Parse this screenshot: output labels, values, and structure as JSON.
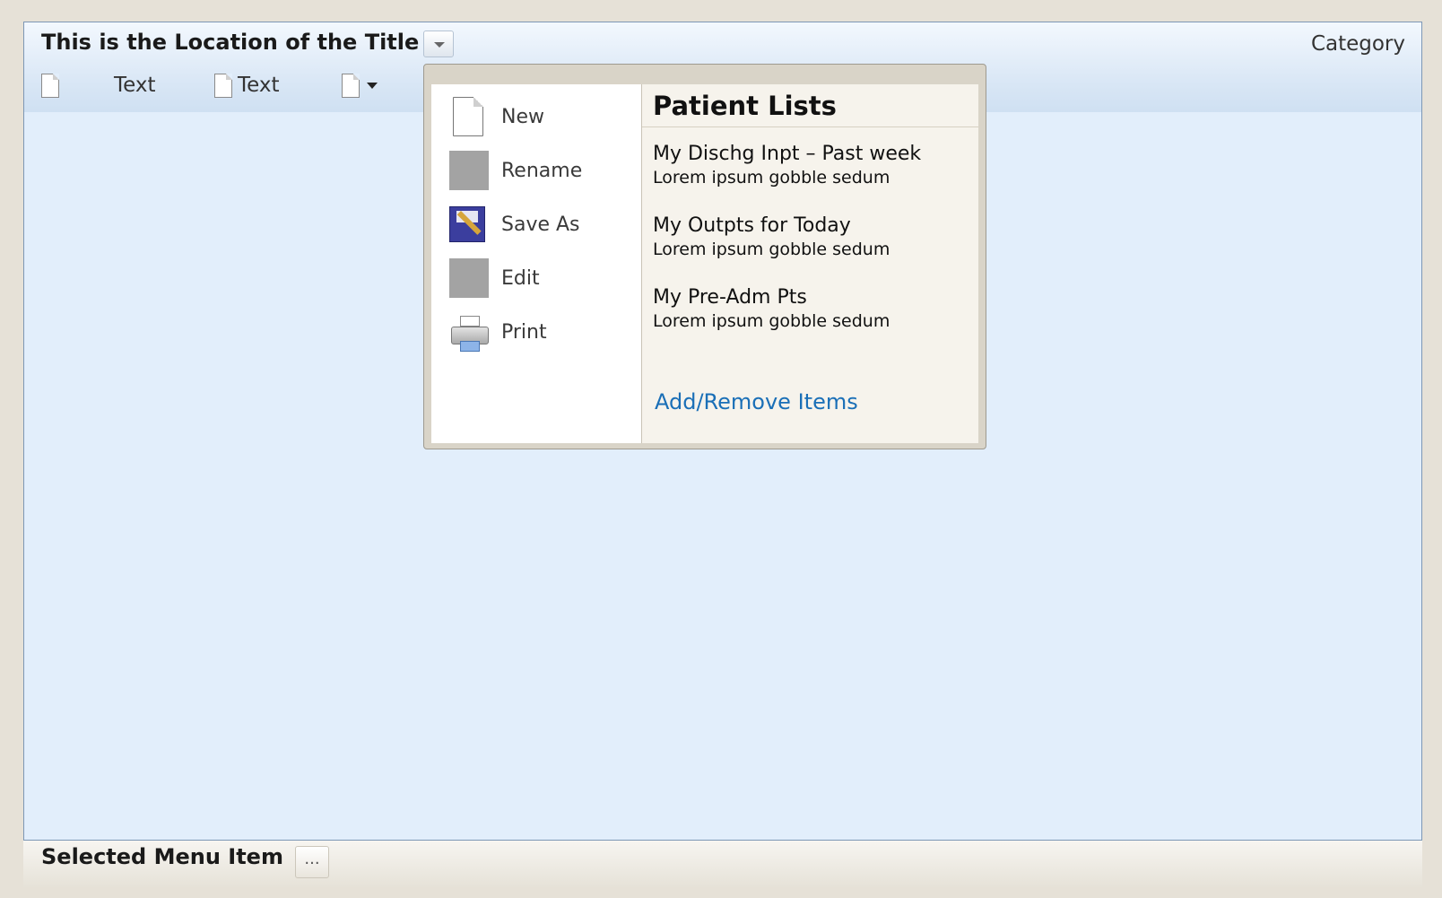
{
  "window": {
    "title": "This is the Location of the Title",
    "category": "Category",
    "toolbar": {
      "items": [
        {
          "label": ""
        },
        {
          "label": "Text"
        },
        {
          "label": "Text"
        }
      ]
    }
  },
  "popup": {
    "menu": [
      {
        "label": "New",
        "icon": "new-document-icon"
      },
      {
        "label": "Rename",
        "icon": "rename-icon"
      },
      {
        "label": "Save As",
        "icon": "save-as-icon"
      },
      {
        "label": "Edit",
        "icon": "edit-icon"
      },
      {
        "label": "Print",
        "icon": "printer-icon"
      }
    ],
    "patient_lists": {
      "title": "Patient Lists",
      "items": [
        {
          "name": "My Dischg Inpt – Past week",
          "description": "Lorem ipsum gobble sedum"
        },
        {
          "name": "My Outpts for Today",
          "description": "Lorem ipsum gobble sedum"
        },
        {
          "name": "My Pre-Adm Pts",
          "description": "Lorem ipsum gobble sedum"
        }
      ],
      "link": "Add/Remove Items"
    }
  },
  "statusbar": {
    "label": "Selected Menu Item",
    "button": "..."
  },
  "colors": {
    "window_bg": "#e2eefb",
    "outer_bg": "#e6e1d7",
    "link": "#1a6fb7"
  }
}
